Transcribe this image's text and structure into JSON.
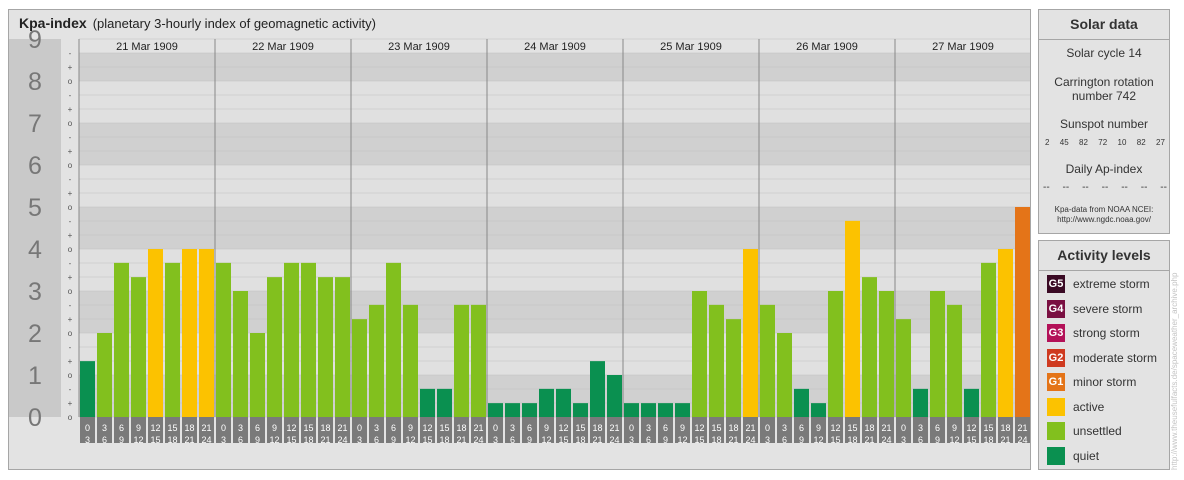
{
  "main": {
    "title": "Kpa-index",
    "subtitle": "(planetary 3-hourly index of geomagnetic activity)"
  },
  "colors": {
    "quiet": "#0a9050",
    "unsettled": "#82c01e",
    "active": "#fcc200",
    "minor_storm": "#e47418",
    "moderate_storm": "#cf3a20",
    "strong_storm": "#b31158",
    "severe_storm": "#7a1042",
    "extreme_storm": "#3a0a24"
  },
  "chart_data": {
    "type": "bar",
    "title": "Kpa-index",
    "subtitle": "(planetary 3-hourly index of geomagnetic activity)",
    "ylim": [
      0,
      9
    ],
    "y_ticks": [
      "0",
      "1",
      "2",
      "3",
      "4",
      "5",
      "6",
      "7",
      "8",
      "9"
    ],
    "minor_ticks": [
      "o",
      "+",
      "-"
    ],
    "days": [
      "21 Mar 1909",
      "22 Mar 1909",
      "23 Mar 1909",
      "24 Mar 1909",
      "25 Mar 1909",
      "26 Mar 1909",
      "27 Mar 1909"
    ],
    "intervals": [
      {
        "start": "0",
        "end": "3"
      },
      {
        "start": "3",
        "end": "6"
      },
      {
        "start": "6",
        "end": "9"
      },
      {
        "start": "9",
        "end": "12"
      },
      {
        "start": "12",
        "end": "15"
      },
      {
        "start": "15",
        "end": "18"
      },
      {
        "start": "18",
        "end": "21"
      },
      {
        "start": "21",
        "end": "24"
      }
    ],
    "series": [
      {
        "values": [
          1.33,
          2.0,
          3.67,
          3.33,
          4.0,
          3.67,
          4.0,
          4.0
        ]
      },
      {
        "values": [
          3.67,
          3.0,
          2.0,
          3.33,
          3.67,
          3.67,
          3.33,
          3.33
        ]
      },
      {
        "values": [
          2.33,
          2.67,
          3.67,
          2.67,
          0.67,
          0.67,
          2.67,
          2.67
        ]
      },
      {
        "values": [
          0.33,
          0.33,
          0.33,
          0.67,
          0.67,
          0.33,
          1.33,
          1.0
        ]
      },
      {
        "values": [
          0.33,
          0.33,
          0.33,
          0.33,
          3.0,
          2.67,
          2.33,
          4.0
        ]
      },
      {
        "values": [
          2.67,
          2.0,
          0.67,
          0.33,
          3.0,
          4.67,
          3.33,
          3.0
        ]
      },
      {
        "values": [
          2.33,
          0.67,
          3.0,
          2.67,
          0.67,
          3.67,
          4.0,
          5.0
        ]
      }
    ]
  },
  "solar": {
    "title": "Solar data",
    "cycle": "Solar cycle 14",
    "carrington_line1": "Carrington rotation",
    "carrington_line2": "number 742",
    "sunspot_title": "Sunspot number",
    "sunspots": [
      "2",
      "45",
      "82",
      "72",
      "10",
      "82",
      "27"
    ],
    "ap_title": "Daily Ap-index",
    "ap": [
      "--",
      "--",
      "--",
      "--",
      "--",
      "--",
      "--"
    ],
    "credit_line1": "Kpa-data from NOAA NCEI:",
    "credit_line2": "http://www.ngdc.noaa.gov/"
  },
  "activity": {
    "title": "Activity levels",
    "levels": [
      {
        "code": "G5",
        "label": "extreme storm",
        "color": "#3a0a24"
      },
      {
        "code": "G4",
        "label": "severe storm",
        "color": "#7a1042"
      },
      {
        "code": "G3",
        "label": "strong storm",
        "color": "#b31158"
      },
      {
        "code": "G2",
        "label": "moderate storm",
        "color": "#cf3a20"
      },
      {
        "code": "G1",
        "label": "minor storm",
        "color": "#e47418"
      },
      {
        "code": "",
        "label": "active",
        "color": "#fcc200"
      },
      {
        "code": "",
        "label": "unsettled",
        "color": "#82c01e"
      },
      {
        "code": "",
        "label": "quiet",
        "color": "#0a9050"
      }
    ]
  },
  "watermark": "http://www.theusefulfacts.de/spaceweather_archive.php"
}
